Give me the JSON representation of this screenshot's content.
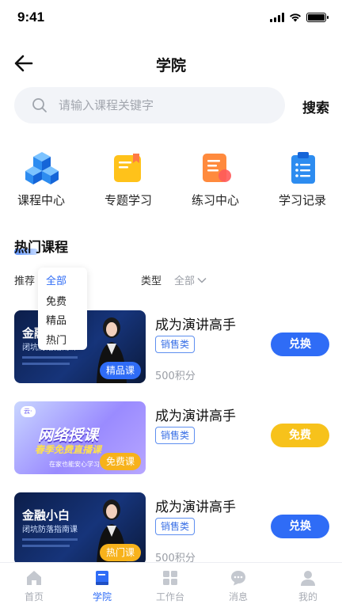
{
  "status": {
    "time": "9:41"
  },
  "header": {
    "title": "学院"
  },
  "search": {
    "placeholder": "请输入课程关键字",
    "button_label": "搜索"
  },
  "categories": [
    {
      "label": "课程中心",
      "icon": "course-center-icon"
    },
    {
      "label": "专题学习",
      "icon": "topic-study-icon"
    },
    {
      "label": "练习中心",
      "icon": "practice-center-icon"
    },
    {
      "label": "学习记录",
      "icon": "study-record-icon"
    }
  ],
  "section": {
    "title": "热门课程"
  },
  "filters": {
    "recommend_label": "推荐",
    "recommend_value": "全部",
    "type_label": "类型",
    "type_value": "全部"
  },
  "dropdown": {
    "options": [
      "免费",
      "精品",
      "热门"
    ]
  },
  "courses": [
    {
      "title": "成为演讲高手",
      "type": "销售类",
      "points": "500积分",
      "button": "兑换",
      "thumb_tag": "精品课",
      "button_color": "#2f6cf6",
      "thumb_text": "金融小白",
      "thumb_sub": "闭坑防落指南课"
    },
    {
      "title": "成为演讲高手",
      "type": "销售类",
      "points": "",
      "button": "免费",
      "thumb_tag": "免费课",
      "button_color": "#f7c21b",
      "thumb_text": "网络授课",
      "thumb_sub": "春季免费直播课",
      "thumb_small": "在家也能安心学习"
    },
    {
      "title": "成为演讲高手",
      "type": "销售类",
      "points": "500积分",
      "button": "兑换",
      "thumb_tag": "热门课",
      "button_color": "#2f6cf6",
      "thumb_text": "金融小白",
      "thumb_sub": "闭坑防落指南课"
    }
  ],
  "tabbar": [
    {
      "label": "首页",
      "icon": "home-icon",
      "active": false
    },
    {
      "label": "学院",
      "icon": "book-icon",
      "active": true
    },
    {
      "label": "工作台",
      "icon": "grid-icon",
      "active": false
    },
    {
      "label": "消息",
      "icon": "message-icon",
      "active": false
    },
    {
      "label": "我的",
      "icon": "person-icon",
      "active": false
    }
  ],
  "colors": {
    "accent": "#2f6cf6",
    "yellow": "#f7c21b"
  }
}
